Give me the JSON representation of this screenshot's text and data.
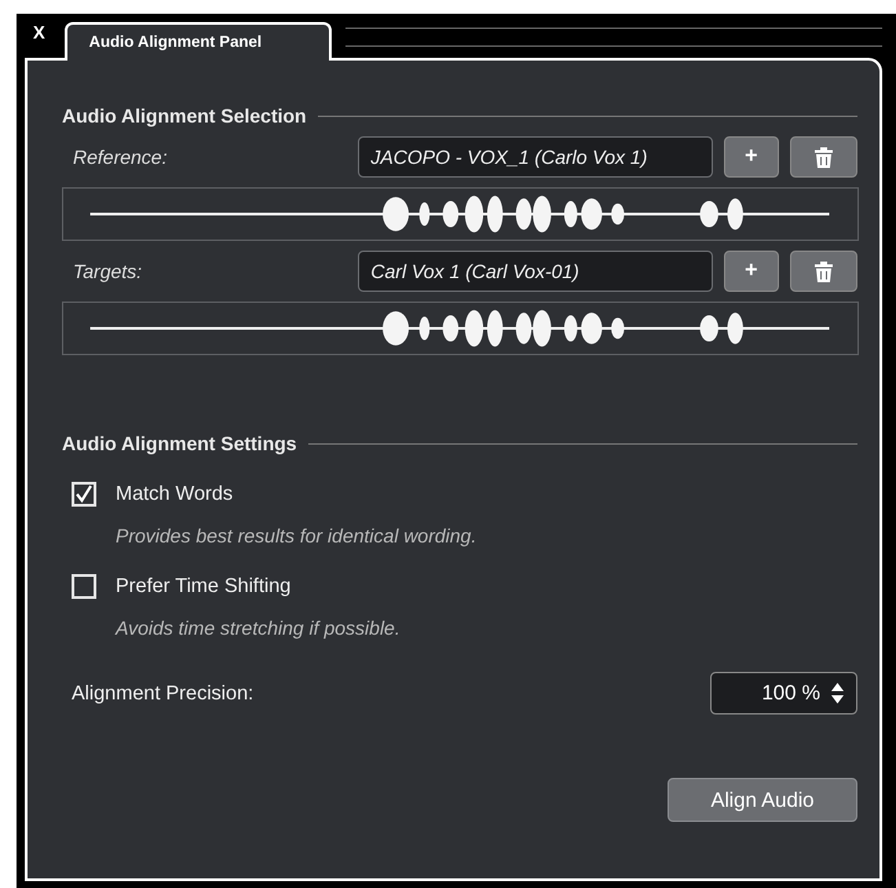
{
  "window": {
    "close_label": "X",
    "tabs": [
      {
        "label": "Audio Alignment Panel",
        "selected": true
      }
    ]
  },
  "selection": {
    "heading": "Audio Alignment Selection",
    "rows": [
      {
        "label": "Reference:",
        "value": "JACOPO - VOX_1 (Carlo Vox 1)",
        "add_label": "+"
      },
      {
        "label": "Targets:",
        "value": "Carl Vox 1 (Carl Vox-01)",
        "add_label": "+"
      }
    ]
  },
  "settings": {
    "heading": "Audio Alignment Settings",
    "options": [
      {
        "label": "Match Words",
        "checked": true,
        "description": "Provides best results for identical wording."
      },
      {
        "label": "Prefer Time Shifting",
        "checked": false,
        "description": "Avoids time stretching if possible."
      }
    ],
    "precision": {
      "label": "Alignment Precision:",
      "value": "100 %"
    }
  },
  "actions": {
    "align_label": "Align Audio"
  }
}
